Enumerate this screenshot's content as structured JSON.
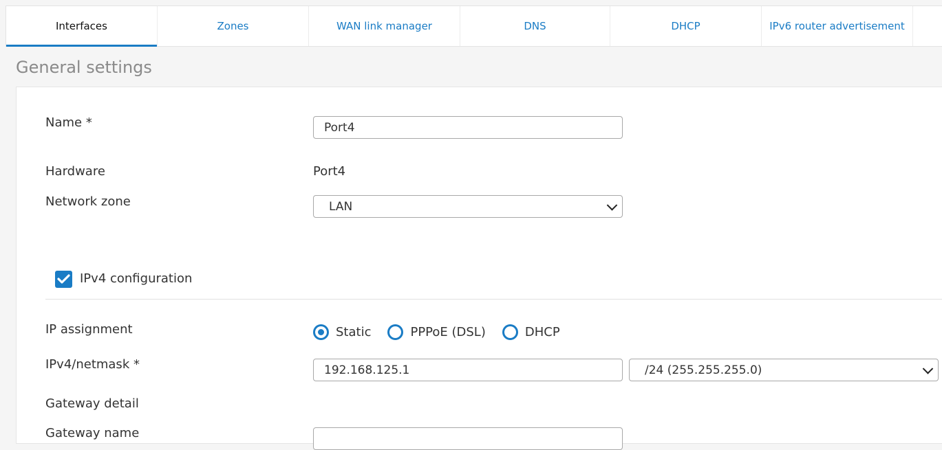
{
  "tabs": [
    {
      "label": "Interfaces",
      "active": true
    },
    {
      "label": "Zones"
    },
    {
      "label": "WAN link manager"
    },
    {
      "label": "DNS"
    },
    {
      "label": "DHCP"
    },
    {
      "label": "IPv6 router advertisement"
    }
  ],
  "section_title": "General settings",
  "form": {
    "name_label": "Name *",
    "name_value": "Port4",
    "hardware_label": "Hardware",
    "hardware_value": "Port4",
    "zone_label": "Network zone",
    "zone_value": "LAN",
    "ipv4_config_label": "IPv4 configuration",
    "ipv4_config_checked": true,
    "ip_assignment_label": "IP assignment",
    "ip_assignment_options": [
      "Static",
      "PPPoE (DSL)",
      "DHCP"
    ],
    "ip_assignment_selected": "Static",
    "ipv4_netmask_label": "IPv4/netmask *",
    "ipv4_value": "192.168.125.1",
    "netmask_value": "/24 (255.255.255.0)",
    "gateway_detail_label": "Gateway detail",
    "gateway_name_label": "Gateway name"
  },
  "colors": {
    "accent": "#1a7cc5",
    "tab_text": "#1a7cc5",
    "background": "#f5f5f5"
  }
}
